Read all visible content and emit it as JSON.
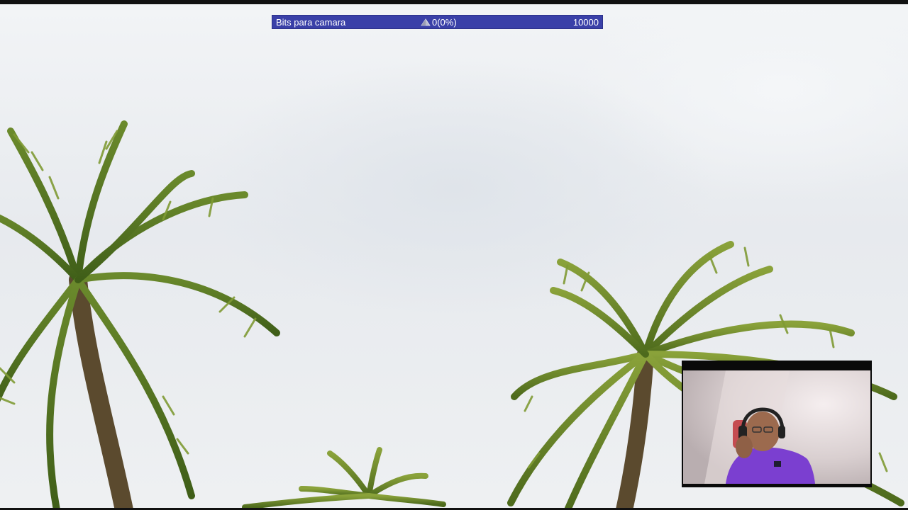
{
  "overlay": {
    "goal": {
      "title": "Bits para camara",
      "progress_text": "0(0%)",
      "progress_fraction": 0.0,
      "target_text": "10000",
      "bar_color": "#3a40a8",
      "icon": "bits-gem-icon"
    }
  },
  "scene": {
    "background": "palm-trees-sky-video",
    "colors": {
      "sky": "#eceef1",
      "frond": "#5a7a22",
      "trunk": "#6b5a3a"
    }
  },
  "webcam": {
    "description_icon": "webcam-feed",
    "shirt_color": "#7b3fd0",
    "wall_color": "#d8cfd0"
  }
}
